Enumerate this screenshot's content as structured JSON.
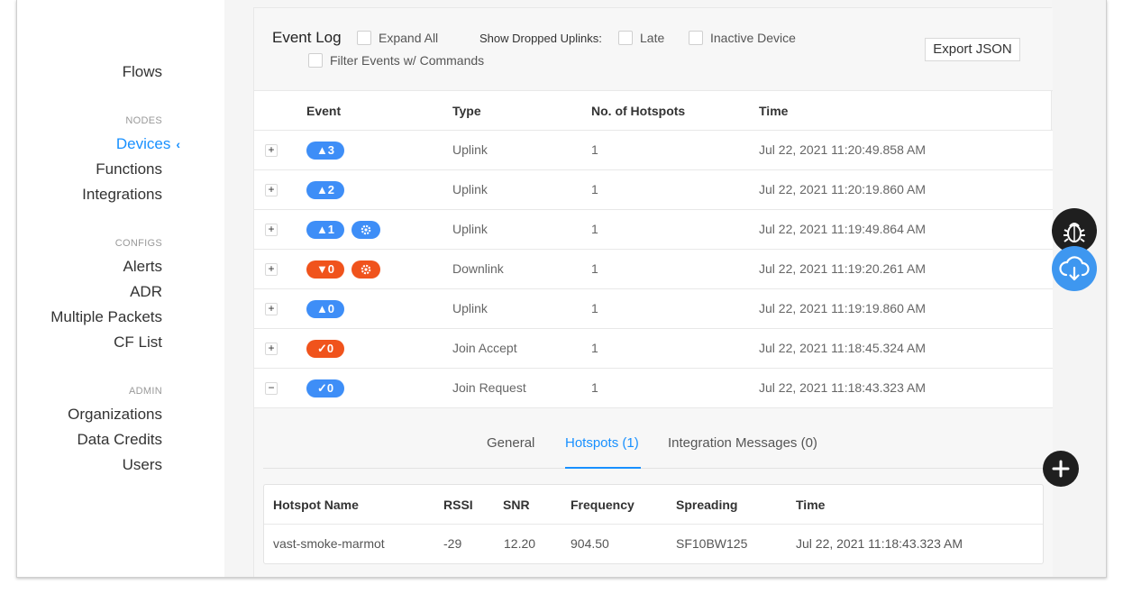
{
  "sidebar": {
    "flows": "Flows",
    "nodes_section": "NODES",
    "devices": "Devices",
    "devices_chevron": "‹",
    "functions": "Functions",
    "integrations": "Integrations",
    "configs_section": "CONFIGS",
    "alerts": "Alerts",
    "adr": "ADR",
    "multiple_packets": "Multiple Packets",
    "cf_list": "CF List",
    "admin_section": "ADMIN",
    "organizations": "Organizations",
    "data_credits": "Data Credits",
    "users": "Users"
  },
  "event_log": {
    "title": "Event Log",
    "expand_all": "Expand All",
    "show_dropped_label": "Show Dropped Uplinks:",
    "late": "Late",
    "inactive_device": "Inactive Device",
    "filter_commands": "Filter Events w/ Commands",
    "export_button": "Export JSON"
  },
  "table": {
    "headers": [
      "Event",
      "Type",
      "No. of Hotspots",
      "Time"
    ],
    "rows": [
      {
        "event": "▲3",
        "color": "#3e8ef7",
        "type": "Uplink",
        "hotspots": "1",
        "time": "Jul 22, 2021 11:20:49.858 AM",
        "expander": "+",
        "gear": false
      },
      {
        "event": "▲2",
        "color": "#3e8ef7",
        "type": "Uplink",
        "hotspots": "1",
        "time": "Jul 22, 2021 11:20:19.860 AM",
        "expander": "+",
        "gear": false
      },
      {
        "event": "▲1",
        "color": "#3e8ef7",
        "type": "Uplink",
        "hotspots": "1",
        "time": "Jul 22, 2021 11:19:49.864 AM",
        "expander": "+",
        "gear": true
      },
      {
        "event": "▼0",
        "color": "#f0531c",
        "type": "Downlink",
        "hotspots": "1",
        "time": "Jul 22, 2021 11:19:20.261 AM",
        "expander": "+",
        "gear": true
      },
      {
        "event": "▲0",
        "color": "#3e8ef7",
        "type": "Uplink",
        "hotspots": "1",
        "time": "Jul 22, 2021 11:19:19.860 AM",
        "expander": "+",
        "gear": false
      },
      {
        "event": "✓0",
        "color": "#f0531c",
        "type": "Join Accept",
        "hotspots": "1",
        "time": "Jul 22, 2021 11:18:45.324 AM",
        "expander": "+",
        "gear": false
      },
      {
        "event": "✓0",
        "color": "#3e8ef7",
        "type": "Join Request",
        "hotspots": "1",
        "time": "Jul 22, 2021 11:18:43.323 AM",
        "expander": "−",
        "gear": false
      }
    ]
  },
  "detail": {
    "tabs": [
      "General",
      "Hotspots (1)",
      "Integration Messages (0)"
    ],
    "active_tab": "Hotspots (1)",
    "hotspot_headers": [
      "Hotspot Name",
      "RSSI",
      "SNR",
      "Frequency",
      "Spreading",
      "Time"
    ],
    "hotspot_row": [
      "vast-smoke-marmot",
      "-29",
      "12.20",
      "904.50",
      "SF10BW125",
      "Jul 22, 2021 11:18:43.323 AM"
    ]
  },
  "icons": {
    "debug": "bug-icon",
    "download": "cloud-download-icon",
    "add": "plus-icon",
    "gear": "gear-icon"
  }
}
